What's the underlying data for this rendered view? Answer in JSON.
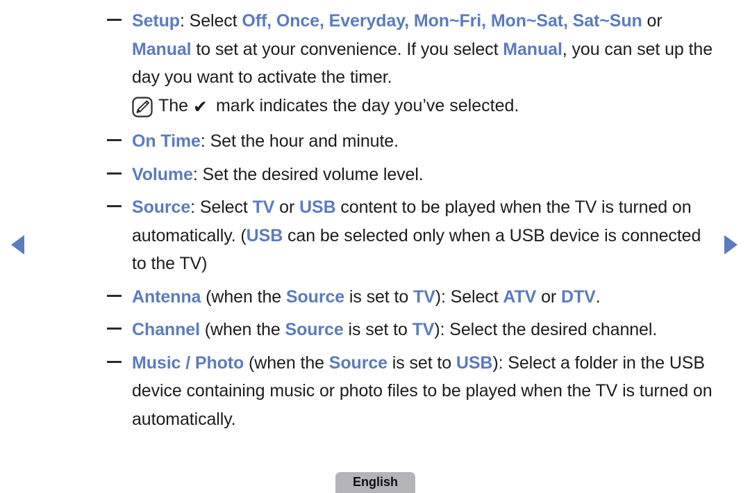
{
  "page": {
    "background_color": "#ffffff",
    "accent_color": "#5b7bc0",
    "text_color": "#1c1c1c"
  },
  "nav": {
    "prev_label": "previous-page-arrow",
    "next_label": "next-page-arrow"
  },
  "content": {
    "items": [
      {
        "term": "Setup",
        "line1_a": ": Select ",
        "opt1": "Off, Once, Everyday, Mon~Fri, Mon~Sat, Sat~Sun",
        "line1_b": " or ",
        "opt2": "Manual",
        "line2_a": " to set at your convenience. If you select ",
        "opt3": "Manual",
        "line2_b": ", you can set up the day you want to activate the timer."
      },
      {
        "term": "On Time",
        "rest": ": Set the hour and minute."
      },
      {
        "term": "Volume",
        "rest": ": Set the desired volume level."
      },
      {
        "term": "Source",
        "a": ": Select ",
        "kw1": "TV",
        "b": " or ",
        "kw2": "USB",
        "c": " content to be played when the TV is turned on automatically. (",
        "kw3": "USB",
        "d": " can be selected only when a USB device is connected to the TV)"
      },
      {
        "term": "Antenna",
        "a": " (when the ",
        "kw1": "Source",
        "b": " is set to ",
        "kw2": "TV",
        "c": "): Select ",
        "kw3": "ATV",
        "d": " or ",
        "kw4": "DTV",
        "e": "."
      },
      {
        "term": "Channel",
        "a": " (when the ",
        "kw1": "Source",
        "b": " is set to ",
        "kw2": "TV",
        "c": "): Select the desired channel."
      },
      {
        "term": "Music / Photo",
        "a": " (when the ",
        "kw1": "Source",
        "b": " is set to ",
        "kw2": "USB",
        "c": "): Select a folder in the USB device containing music or photo files to be played when the TV is turned on automatically."
      }
    ],
    "note": {
      "icon_name": "note-pen-icon",
      "text_before": "The ",
      "check_glyph": "✔",
      "text_after": " mark indicates the day you’ve selected."
    }
  },
  "footer": {
    "language_label": "English"
  }
}
